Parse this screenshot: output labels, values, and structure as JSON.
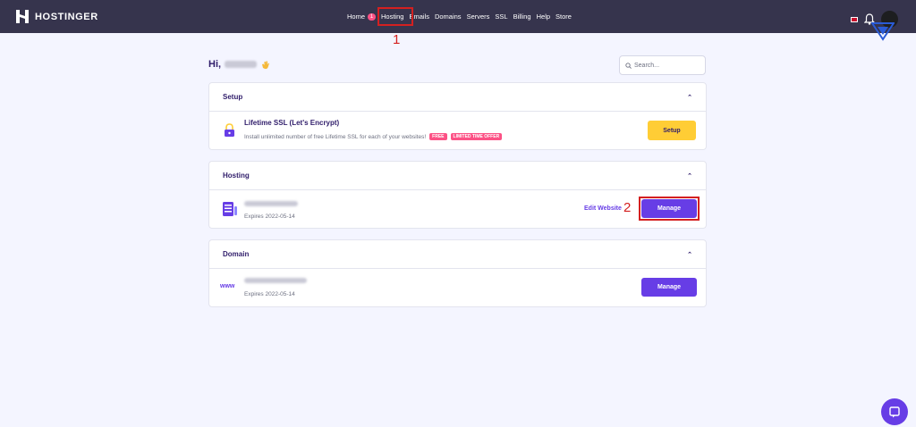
{
  "brand": {
    "name": "HOSTINGER"
  },
  "nav": {
    "items": [
      {
        "label": "Home",
        "badge": "1"
      },
      {
        "label": "Hosting"
      },
      {
        "label": "Emails"
      },
      {
        "label": "Domains"
      },
      {
        "label": "Servers"
      },
      {
        "label": "SSL"
      },
      {
        "label": "Billing"
      },
      {
        "label": "Help"
      },
      {
        "label": "Store"
      }
    ]
  },
  "annotations": {
    "step1": "1",
    "step2": "2"
  },
  "greeting": {
    "prefix": "Hi,"
  },
  "search": {
    "placeholder": "Search..."
  },
  "setup": {
    "header": "Setup",
    "item": {
      "title": "Lifetime SSL (Let's Encrypt)",
      "description": "Install unlimited number of free Lifetime SSL for each of your websites!",
      "tags": [
        "FREE",
        "LIMITED TIME OFFER"
      ],
      "button": "Setup"
    }
  },
  "hosting": {
    "header": "Hosting",
    "item": {
      "expires": "Expires 2022-05-14",
      "edit_label": "Edit Website",
      "button": "Manage"
    }
  },
  "domain": {
    "header": "Domain",
    "item": {
      "icon_text": "www",
      "expires": "Expires 2022-05-14",
      "button": "Manage"
    }
  },
  "colors": {
    "topbar": "#36344d",
    "accent": "#673de6",
    "highlight": "#d42020",
    "setup_button": "#ffcd35",
    "tag": "#fc5185"
  }
}
